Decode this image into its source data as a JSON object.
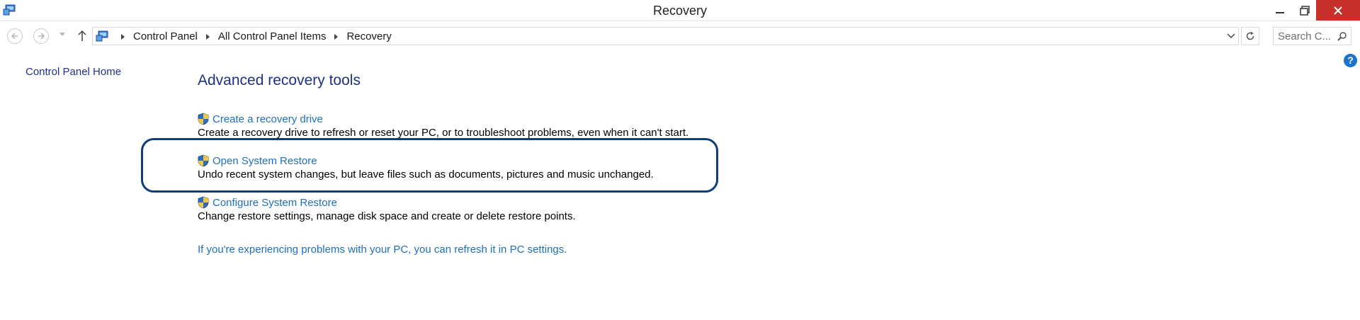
{
  "window": {
    "title": "Recovery",
    "app_icon": "control-panel-icon",
    "controls": [
      "minimize-icon",
      "maximize-icon",
      "close-icon"
    ],
    "close_color": "#c7302b"
  },
  "navigation": {
    "back_icon": "back-arrow-icon",
    "forward_icon": "forward-arrow-icon",
    "history_icon": "chevron-down-icon",
    "up_icon": "up-arrow-icon",
    "breadcrumbs": [
      "Control Panel",
      "All Control Panel Items",
      "Recovery"
    ],
    "refresh_icon": "refresh-icon",
    "search": {
      "placeholder": "Search C...",
      "icon": "search-icon"
    }
  },
  "sidebar": {
    "home_link": "Control Panel Home"
  },
  "help_icon": "help-icon",
  "main": {
    "heading": "Advanced recovery tools",
    "items": [
      {
        "title": "Create a recovery drive",
        "description": "Create a recovery drive to refresh or reset your PC, or to troubleshoot problems, even when it can't start.",
        "icon": "uac-shield-icon"
      },
      {
        "title": "Open System Restore",
        "description": "Undo recent system changes, but leave files such as documents, pictures and music unchanged.",
        "icon": "uac-shield-icon",
        "highlighted": true
      },
      {
        "title": "Configure System Restore",
        "description": "Change restore settings, manage disk space and create or delete restore points.",
        "icon": "uac-shield-icon"
      }
    ],
    "refresh_link": "If you're experiencing problems with your PC, you can refresh it in PC settings."
  },
  "colors": {
    "heading": "#1e3287",
    "link": "#1e6fbd",
    "highlight_border": "#0f3d7a"
  }
}
